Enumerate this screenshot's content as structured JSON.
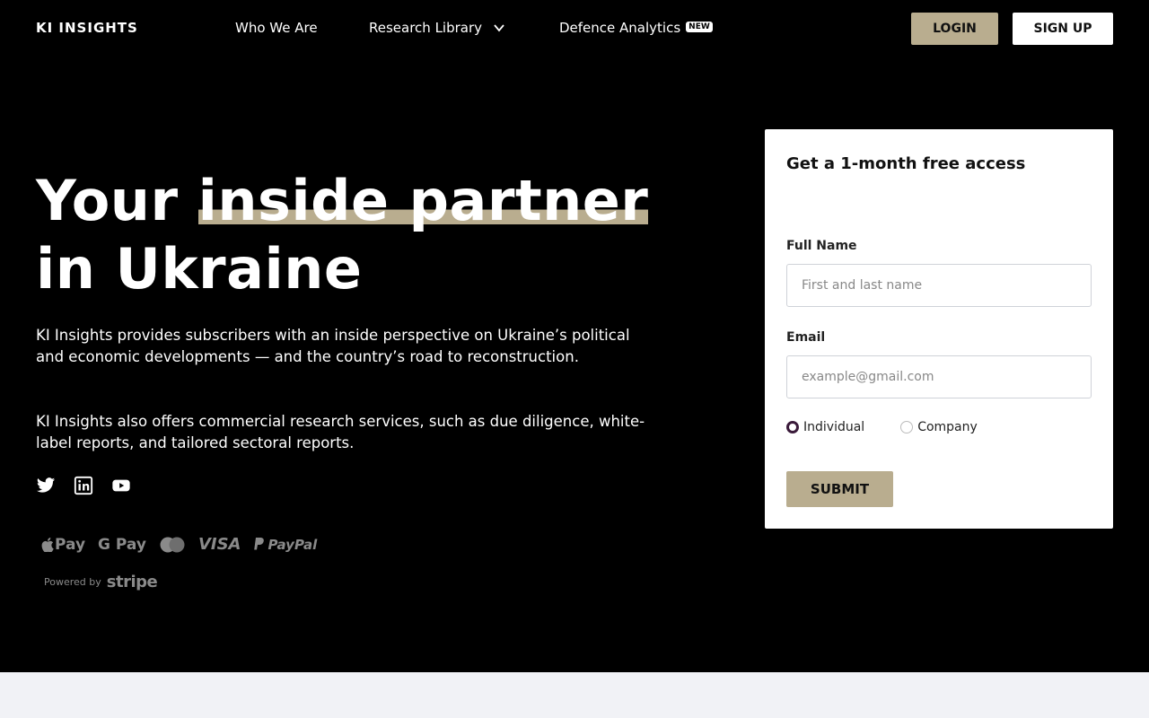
{
  "header": {
    "logo": "KI INSIGHTS",
    "nav": [
      {
        "label": "Who We Are"
      },
      {
        "label": "Research Library"
      },
      {
        "label": "Defence Analytics",
        "badge": "NEW"
      }
    ],
    "login_label": "LOGIN",
    "signup_label": "SIGN UP"
  },
  "hero": {
    "title_part1": "Your ",
    "title_highlight": "inside partner",
    "title_part2": "in Ukraine",
    "paragraph1": "KI Insights provides subscribers with an inside perspective on Ukraine’s political and economic developments — and the country’s road to reconstruction.",
    "paragraph2": "KI Insights also offers commercial research services, such as due diligence, white-label reports, and tailored sectoral reports.",
    "socials": [
      "twitter-icon",
      "linkedin-icon",
      "youtube-icon"
    ]
  },
  "payments": {
    "apple_pay": "Pay",
    "google_pay": "G Pay",
    "visa": "VISA",
    "paypal": "PayPal",
    "powered_by": "Powered by",
    "stripe": "stripe"
  },
  "form": {
    "title": "Get a 1-month free access",
    "full_name_label": "Full Name",
    "full_name_placeholder": "First and last name",
    "email_label": "Email",
    "email_placeholder": "example@gmail.com",
    "radio_individual": "Individual",
    "radio_company": "Company",
    "selected": "Individual",
    "submit_label": "SUBMIT"
  },
  "colors": {
    "accent": "#b9ad8f",
    "background": "#000000",
    "bottom_band": "#f1f2f6"
  }
}
